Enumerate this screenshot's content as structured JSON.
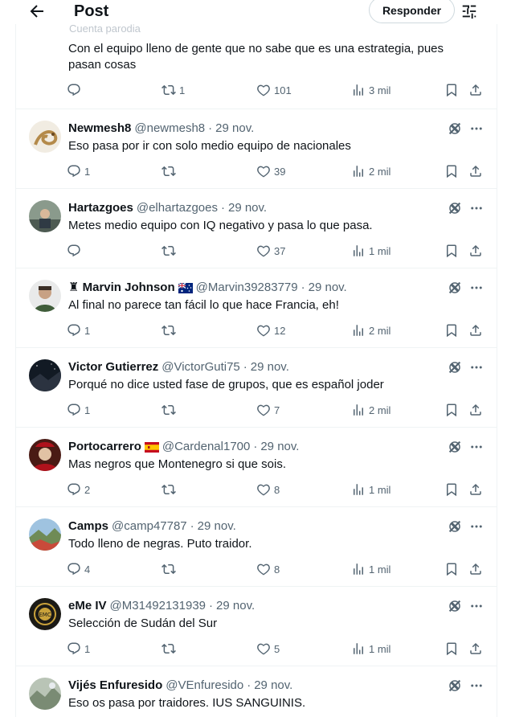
{
  "header": {
    "title": "Post",
    "reply_button": "Responder"
  },
  "original_post": {
    "parody_label": "Cuenta parodia",
    "text": "Con el equipo lleno de gente que no sabe que es una estrategia, pues pasan cosas",
    "stats": {
      "replies": "",
      "reposts": "1",
      "likes": "101",
      "views": "3 mil"
    }
  },
  "replies": [
    {
      "name": "Newmesh8",
      "handle": "@newmesh8",
      "date": "29 nov.",
      "text": "Eso pasa por ir con solo medio equipo de nacionales",
      "stats": {
        "replies": "1",
        "reposts": "",
        "likes": "39",
        "views": "2 mil"
      }
    },
    {
      "name": "Hartazgoes",
      "handle": "@elhartazgoes",
      "date": "29 nov.",
      "text": "Metes medio equipo con IQ negativo y pasa lo que pasa.",
      "stats": {
        "replies": "",
        "reposts": "",
        "likes": "37",
        "views": "1 mil"
      }
    },
    {
      "name": "♜ Marvin Johnson",
      "handle": "@Marvin39283779",
      "date": "29 nov.",
      "text": "Al final no parece tan fácil lo que hace Francia, eh!",
      "flag": "australia-flag",
      "stats": {
        "replies": "1",
        "reposts": "",
        "likes": "12",
        "views": "2 mil"
      }
    },
    {
      "name": "Victor Gutierrez",
      "handle": "@VictorGuti75",
      "date": "29 nov.",
      "text": "Porqué no dice usted fase de grupos, que es español joder",
      "stats": {
        "replies": "1",
        "reposts": "",
        "likes": "7",
        "views": "2 mil"
      }
    },
    {
      "name": "Portocarrero",
      "handle": "@Cardenal1700",
      "date": "29 nov.",
      "text": "Mas negros que Montenegro si que sois.",
      "flag": "spain-flag",
      "stats": {
        "replies": "2",
        "reposts": "",
        "likes": "8",
        "views": "1 mil"
      }
    },
    {
      "name": "Camps",
      "handle": "@camp47787",
      "date": "29 nov.",
      "text": "Todo lleno de negras. Puto traidor.",
      "stats": {
        "replies": "4",
        "reposts": "",
        "likes": "8",
        "views": "1 mil"
      }
    },
    {
      "name": "eMe IV",
      "handle": "@M31492131939",
      "date": "29 nov.",
      "text": "Selección de Sudán del Sur",
      "stats": {
        "replies": "1",
        "reposts": "",
        "likes": "5",
        "views": "1 mil"
      }
    },
    {
      "name": "Vijés Enfuresido",
      "handle": "@VEnfuresido",
      "date": "29 nov.",
      "text": "Eso os pasa por traidores. IUS SANGUINIS.",
      "stats": {
        "replies": "",
        "reposts": "",
        "likes": "",
        "views": ""
      }
    }
  ],
  "colors": {
    "text": "#0f1419",
    "secondary": "#536471",
    "border": "#eff3f4",
    "background": "#ffffff"
  },
  "icons": [
    "back-arrow-icon",
    "filter-icon",
    "reply-icon",
    "repost-icon",
    "like-icon",
    "views-icon",
    "bookmark-icon",
    "share-icon",
    "grok-icon",
    "more-icon"
  ]
}
